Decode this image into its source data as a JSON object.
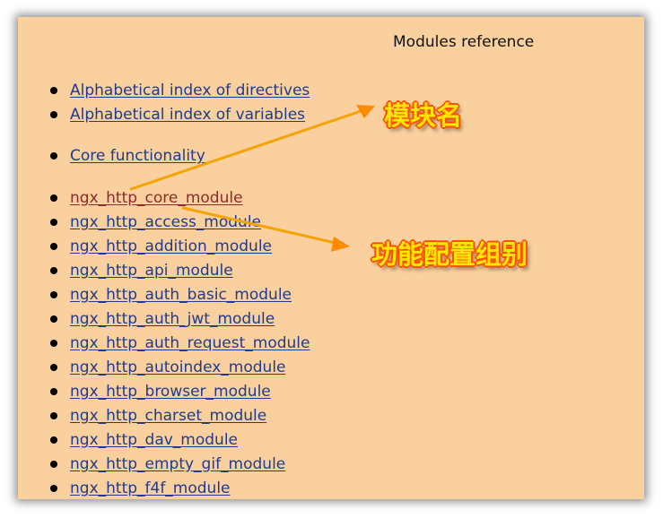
{
  "page": {
    "title": "Modules reference"
  },
  "index_links": [
    {
      "label": "Alphabetical index of directives"
    },
    {
      "label": "Alphabetical index of variables"
    }
  ],
  "core_links": [
    {
      "label": "Core functionality"
    }
  ],
  "module_links": [
    {
      "label": "ngx_http_core_module",
      "visited": true
    },
    {
      "label": "ngx_http_access_module"
    },
    {
      "label": "ngx_http_addition_module"
    },
    {
      "label": "ngx_http_api_module"
    },
    {
      "label": "ngx_http_auth_basic_module"
    },
    {
      "label": "ngx_http_auth_jwt_module"
    },
    {
      "label": "ngx_http_auth_request_module"
    },
    {
      "label": "ngx_http_autoindex_module"
    },
    {
      "label": "ngx_http_browser_module"
    },
    {
      "label": "ngx_http_charset_module"
    },
    {
      "label": "ngx_http_dav_module"
    },
    {
      "label": "ngx_http_empty_gif_module"
    },
    {
      "label": "ngx_http_f4f_module"
    }
  ],
  "annotations": {
    "module_name": "模块名",
    "function_group": "功能配置组别"
  },
  "colors": {
    "page_background": "#f9d09e",
    "link": "#1f3a8f",
    "visited_link": "#8b2c2c",
    "annotation_fill": "#ffe600",
    "annotation_outline": "#ff4f00",
    "arrow": "#f5a300"
  }
}
